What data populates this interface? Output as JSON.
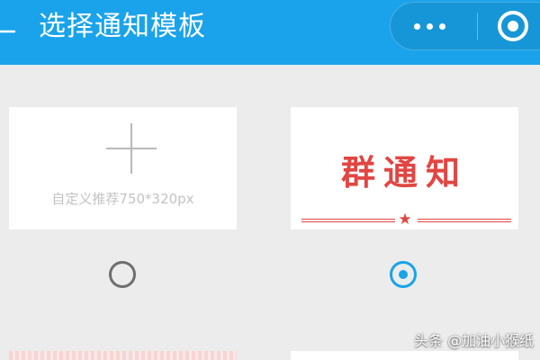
{
  "colors": {
    "brand_blue": "#1aa3ea",
    "background": "#ececec",
    "template_red": "#e14642"
  },
  "header": {
    "back_icon": "back-arrow-icon",
    "title": "选择通知模板",
    "more_icon": "more-dots-icon",
    "close_icon": "close-target-icon"
  },
  "templates": [
    {
      "label": "自定义推荐750*320px",
      "icon": "plus-icon",
      "selected": false
    },
    {
      "title": "群通知",
      "ornament_icon": "star-icon",
      "selected": true
    }
  ],
  "watermark": "头条 @加油小猴纸"
}
